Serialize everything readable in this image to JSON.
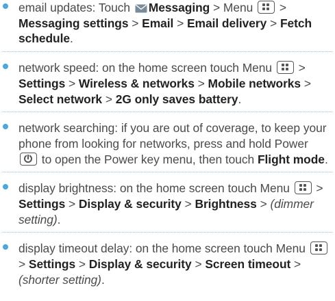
{
  "colors": {
    "bullet": "#4ea8dc",
    "text": "#4a4a4a",
    "bold": "#222222"
  },
  "icons": {
    "messaging": "mail-icon",
    "menu": "menu-key-icon",
    "power": "power-key-icon"
  },
  "items": [
    {
      "intro": "email updates: Touch",
      "messaging": "Messaging",
      "sep1": " > Menu ",
      "sep2": " > ",
      "messaging_settings": "Messaging settings",
      "sep3": " > ",
      "email": "Email",
      "sep4": " > ",
      "email_delivery": "Email delivery",
      "sep5": " > ",
      "fetch_schedule": "Fetch schedule",
      "end": "."
    },
    {
      "intro": "network speed: on the home screen touch Menu ",
      "sep1": " > ",
      "settings": "Settings",
      "sep2": " > ",
      "wireless": "Wireless & networks",
      "sep3": " > ",
      "mobile": "Mobile networks",
      "sep4": " > ",
      "select": "Select network",
      "sep5": " > ",
      "twog": "2G only saves battery",
      "end": "."
    },
    {
      "intro": "network searching: if you are out of coverage, to keep your phone from looking for networks, press and hold Power ",
      "mid": " to open the Power key menu, then touch ",
      "flight": "Flight mode",
      "end": "."
    },
    {
      "intro": "display brightness: on the home screen touch Menu ",
      "sep1": " > ",
      "settings": "Settings",
      "sep2": " > ",
      "display": "Display & security",
      "sep3": " > ",
      "brightness": "Brightness",
      "sep4": " > ",
      "dimmer": "(dimmer setting)",
      "end": "."
    },
    {
      "intro": "display timeout delay: on the home screen touch Menu ",
      "sep1": " > ",
      "settings": "Settings",
      "sep2": " > ",
      "display": "Display & security",
      "sep3": " > ",
      "timeout": "Screen timeout",
      "sep4": " > ",
      "shorter": "(shorter setting)",
      "end": "."
    }
  ]
}
